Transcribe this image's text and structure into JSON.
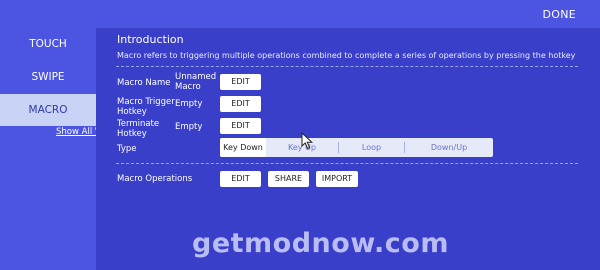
{
  "header": {
    "done_label": "DONE"
  },
  "sidebar": {
    "items": [
      {
        "label": "TOUCH"
      },
      {
        "label": "SWIPE"
      },
      {
        "label": "MACRO"
      }
    ],
    "show_all_label": "Show All V"
  },
  "intro": {
    "title": "Introduction",
    "description": "Macro refers to triggering multiple operations combined to complete a series of operations by pressing the hotkey"
  },
  "rows": {
    "macro_name": {
      "label": "Macro Name",
      "value": "Unnamed Macro",
      "button": "EDIT"
    },
    "trigger_hotkey": {
      "label": "Macro Trigger Hotkey",
      "value": "Empty",
      "button": "EDIT"
    },
    "terminate_hotkey": {
      "label": "Terminate Hotkey",
      "value": "Empty",
      "button": "EDIT"
    },
    "type": {
      "label": "Type",
      "options": [
        "Key Down",
        "Key Up",
        "Loop",
        "Down/Up"
      ],
      "selected": "Key Down"
    }
  },
  "operations": {
    "label": "Macro Operations",
    "edit": "EDIT",
    "share": "SHARE",
    "import": "IMPORT"
  },
  "watermark": "getmodnow.com"
}
